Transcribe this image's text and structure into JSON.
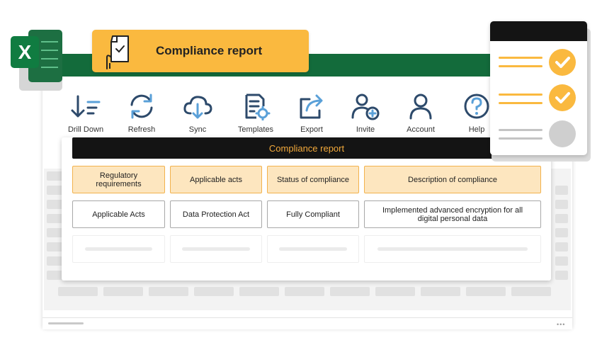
{
  "app": {
    "logo_letter": "X"
  },
  "title_badge": {
    "text": "Compliance report"
  },
  "ribbon": [
    {
      "label": "Drill Down",
      "icon": "drill-down-icon"
    },
    {
      "label": "Refresh",
      "icon": "refresh-icon"
    },
    {
      "label": "Sync",
      "icon": "cloud-sync-icon"
    },
    {
      "label": "Templates",
      "icon": "templates-icon"
    },
    {
      "label": "Export",
      "icon": "export-icon"
    },
    {
      "label": "Invite",
      "icon": "invite-user-icon"
    },
    {
      "label": "Account",
      "icon": "account-icon"
    },
    {
      "label": "Help",
      "icon": "help-icon"
    }
  ],
  "report": {
    "title": "Compliance report",
    "headers": [
      "Regulatory requirements",
      "Applicable acts",
      "Status of compliance",
      "Description of compliance"
    ],
    "row": [
      "Applicable Acts",
      "Data Protection Act",
      "Fully Compliant",
      "Implemented advanced encryption for all digital personal data"
    ]
  },
  "checklist": {
    "items": [
      "checked",
      "checked",
      "unchecked"
    ]
  },
  "colors": {
    "accent": "#fab93f",
    "excel_green": "#136b3b",
    "header_bg": "#141414",
    "header_text": "#f2a93b"
  }
}
